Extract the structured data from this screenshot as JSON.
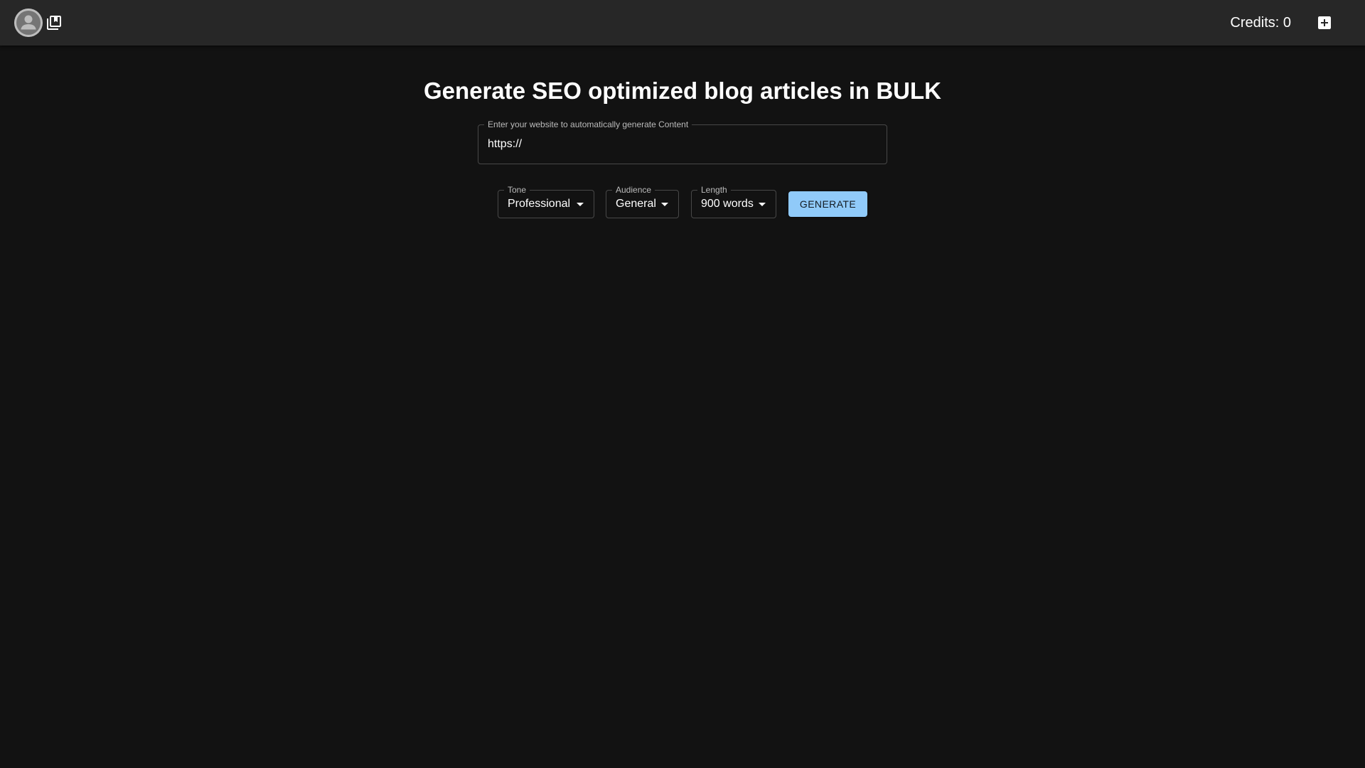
{
  "header": {
    "avatar_icon": "account-circle-icon",
    "library_icon": "library-books-icon",
    "credits_text": "Credits: 0",
    "add_icon": "add-box-icon"
  },
  "main": {
    "title": "Generate SEO optimized blog articles in BULK",
    "website_field": {
      "label": "Enter your website to automatically generate Content",
      "value": "https://"
    },
    "tone": {
      "label": "Tone",
      "value": "Professional"
    },
    "audience": {
      "label": "Audience",
      "value": "General"
    },
    "length": {
      "label": "Length",
      "value": "900 words"
    },
    "generate_label": "GENERATE"
  },
  "colors": {
    "background": "#121212",
    "appbar": "#272727",
    "primary_button": "#90caf9"
  }
}
